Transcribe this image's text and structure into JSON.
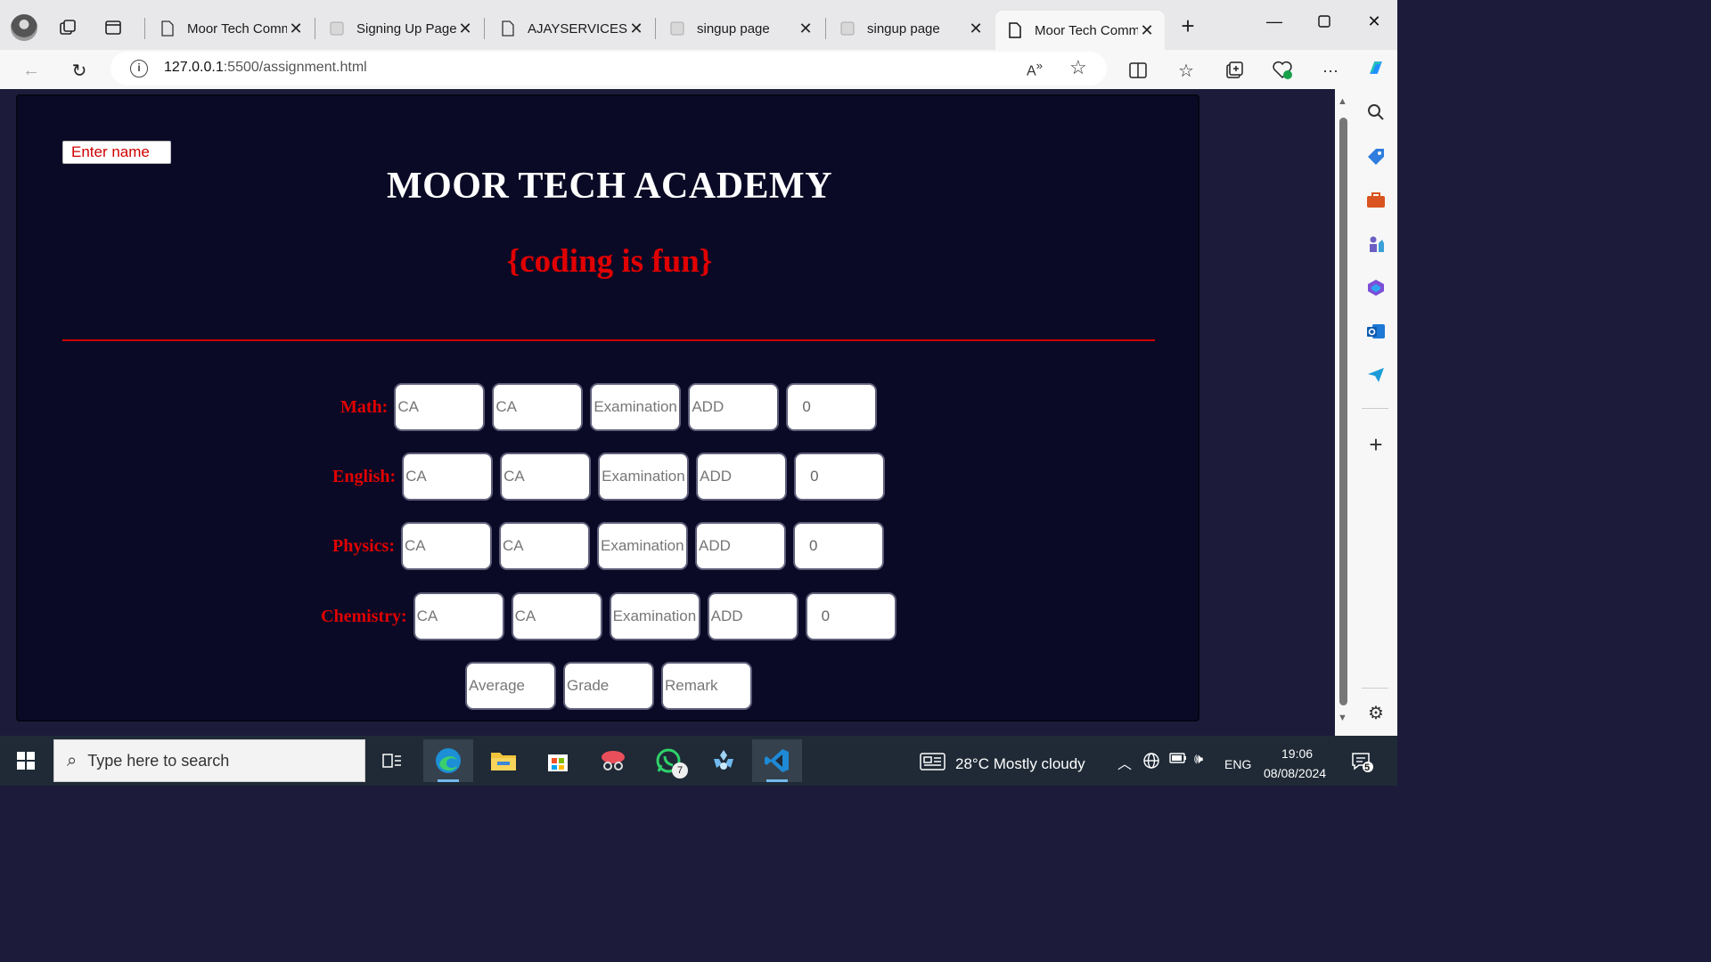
{
  "browser": {
    "tabs": [
      {
        "title": "Moor Tech Comm",
        "active": false
      },
      {
        "title": "Signing Up Page",
        "active": false
      },
      {
        "title": "AJAYSERVICES",
        "active": false
      },
      {
        "title": "singup page",
        "active": false
      },
      {
        "title": "singup page",
        "active": false
      },
      {
        "title": "Moor Tech Comm",
        "active": true
      }
    ],
    "url_host": "127.0.0.1",
    "url_path": ":5500/assignment.html"
  },
  "page": {
    "name_placeholder": "Enter name",
    "title": "MOOR TECH ACADEMY",
    "tagline": "{coding is fun}",
    "colors": {
      "accent": "#e00000",
      "background": "#0b0a26",
      "title": "#ffffff"
    },
    "subjects": [
      {
        "label": "Math:",
        "ca1": "CA",
        "ca2": "CA",
        "exam": "Examination",
        "add": "ADD",
        "total": "0"
      },
      {
        "label": "English:",
        "ca1": "CA",
        "ca2": "CA",
        "exam": "Examination",
        "add": "ADD",
        "total": "0"
      },
      {
        "label": "Physics:",
        "ca1": "CA",
        "ca2": "CA",
        "exam": "Examination",
        "add": "ADD",
        "total": "0"
      },
      {
        "label": "Chemistry:",
        "ca1": "CA",
        "ca2": "CA",
        "exam": "Examination",
        "add": "ADD",
        "total": "0"
      }
    ],
    "summary": {
      "average": "Average",
      "grade": "Grade",
      "remark": "Remark"
    }
  },
  "taskbar": {
    "search_placeholder": "Type here to search",
    "whatsapp_badge": "7",
    "weather": "28°C  Mostly cloudy",
    "language": "ENG",
    "time": "19:06",
    "date": "08/08/2024",
    "notifications": "5"
  }
}
